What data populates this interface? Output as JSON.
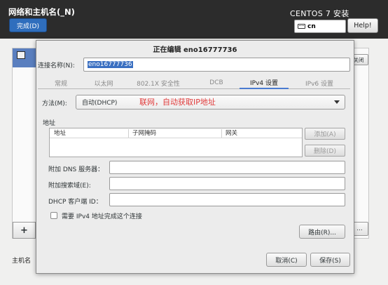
{
  "header": {
    "title": "网络和主机名(_N)",
    "done_label": "完成(D)",
    "product": "CENTOS 7 安装",
    "keyboard_layout": "cn",
    "help_label": "Help!"
  },
  "background": {
    "close_label": "关闭",
    "add_label": "+",
    "more_label": "...",
    "hostname_label": "主机名"
  },
  "dialog": {
    "title": "正在编辑 eno16777736",
    "connection_name_label": "连接名称(N):",
    "connection_name_value": "eno16777736",
    "tabs": [
      {
        "label": "常规"
      },
      {
        "label": "以太网"
      },
      {
        "label": "802.1X 安全性"
      },
      {
        "label": "DCB"
      },
      {
        "label": "IPv4 设置"
      },
      {
        "label": "IPv6 设置"
      }
    ],
    "active_tab": "IPv4 设置",
    "method_label": "方法(M):",
    "method_value": "自动(DHCP)",
    "annotation": "联网，自动获取IP地址",
    "address_label": "地址",
    "address_columns": [
      "地址",
      "子网掩码",
      "网关"
    ],
    "add_button": "添加(A)",
    "delete_button": "删除(D)",
    "dns_label": "附加 DNS 服务器：",
    "dns_value": "",
    "search_domain_label": "附加搜索域(E):",
    "search_domain_value": "",
    "dhcp_client_id_label": "DHCP 客户端 ID：",
    "dhcp_client_id_value": "",
    "require_ipv4_label": "需要 IPv4 地址完成这个连接",
    "require_ipv4_checked": false,
    "routes_button": "路由(R)...",
    "cancel_button": "取消(C)",
    "save_button": "保存(S)"
  },
  "colors": {
    "topbar": "#2c2c2c",
    "accent": "#2f6ebd",
    "annotation": "#e03a3a"
  }
}
